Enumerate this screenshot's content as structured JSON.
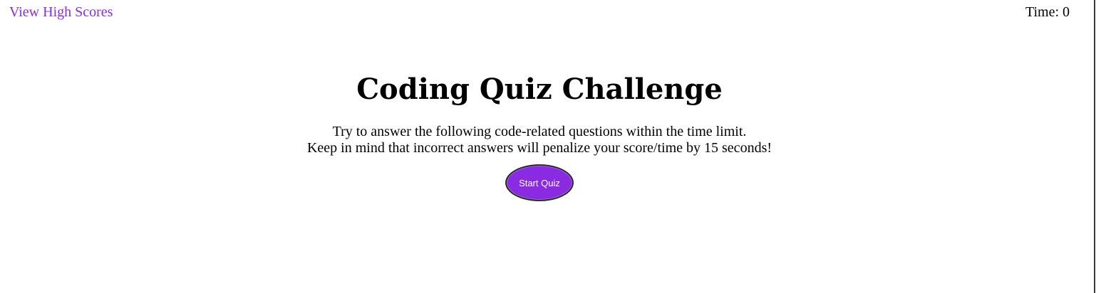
{
  "header": {
    "high_scores_link": "View High Scores",
    "timer_label": "Time: ",
    "timer_value": "0"
  },
  "main": {
    "title": "Coding Quiz Challenge",
    "instructions_line1": "Try to answer the following code-related questions within the time limit.",
    "instructions_line2": "Keep in mind that incorrect answers will penalize your score/time by 15 seconds!",
    "start_button_label": "Start Quiz"
  },
  "colors": {
    "accent": "#8a2be2",
    "button_text": "#ffffff",
    "text": "#000000",
    "background": "#ffffff"
  }
}
